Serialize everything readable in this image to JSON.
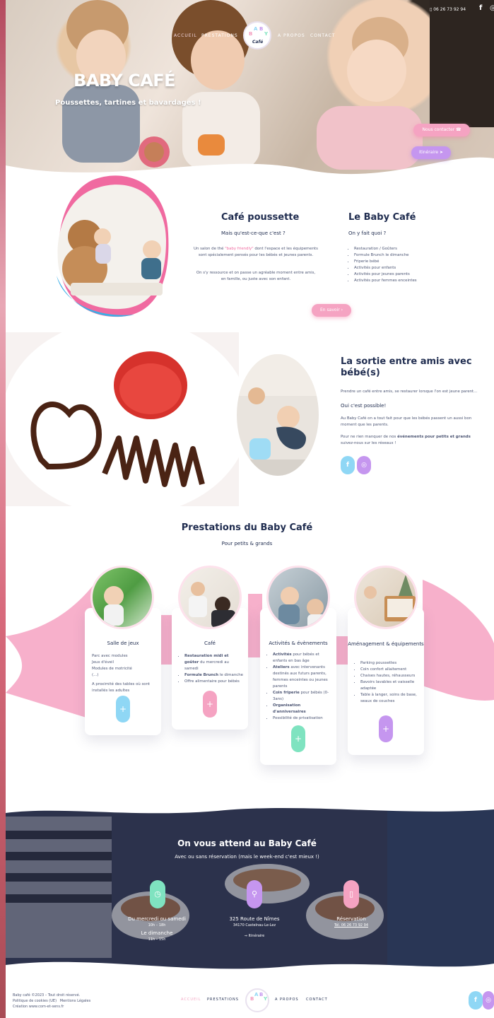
{
  "nav": {
    "items": [
      "Accueil",
      "Prestations",
      "A propos",
      "Contact"
    ],
    "phone": "06 26 73 92 94",
    "facebook": "f",
    "instagram": "◎"
  },
  "hero": {
    "title": "BABY CAFÉ",
    "subtitle": "Poussettes, tartines et bavardages !",
    "contact_button": "Nous contacter ☎",
    "itinerary_button": "Itinéraire ➤"
  },
  "logo": {
    "letters": [
      "B",
      "A",
      "B",
      "Y"
    ],
    "text": "Café"
  },
  "cafe_poussette": {
    "title": "Café poussette",
    "subtitle": "Mais qu'est-ce-que c'est ?",
    "p1_before": "Un salon de thé ",
    "p1_highlight": "\"baby friendly\"",
    "p1_after": " dont l'espace et les équipements sont spécialement pensés pour les bébés et jeunes parents.",
    "p2": "On s'y ressource et on passe un agréable moment entre amis, en famille, ou juste avec son enfant."
  },
  "le_baby_cafe": {
    "title": "Le Baby Café",
    "subtitle": "On y fait quoi ?",
    "items": [
      "Restauration / Goûters",
      "Formule Brunch le dimanche",
      "Friperie bébé",
      "Activités pour enfants",
      "Activités pour jeunes parents",
      "Activités pour femmes enceintes"
    ],
    "button": "En savoir ›"
  },
  "sortie": {
    "title": "La sortie entre amis avec bébé(s)",
    "intro": "Prendre un café entre amis, se restaurer lorsque l'on est jeune parent...",
    "subtitle": "Oui c'est possible!",
    "p1": "Au Baby Café on a tout fait pour que les bébés passent un aussi bon moment que les parents.",
    "p2_before": "Pour ne rien manquer de nos ",
    "p2_bold": "événements pour petits et grands",
    "p2_after": " suivez-nous sur les réseaux !"
  },
  "prestations": {
    "title": "Prestations du Baby Café",
    "subtitle": "Pour petits & grands",
    "cards": [
      {
        "title": "Salle de jeux",
        "lines": [
          "Parc avec modules",
          "Jeux d'éveil",
          "Modules de motricité",
          "(...)",
          "",
          "A proximité des tables où sont installés les adultes"
        ]
      },
      {
        "title": "Café",
        "bullets": [
          {
            "bold": "Restauration midi et goûter",
            "rest": " du mercredi au samedi"
          },
          {
            "bold": "Formule Brunch",
            "rest": " le dimanche"
          },
          {
            "bold": "",
            "rest": "Offre alimentaire pour bébés"
          }
        ]
      },
      {
        "title": "Activités & évènements",
        "bullets": [
          {
            "bold": "Activités",
            "rest": " pour bébés et enfants en bas âge"
          },
          {
            "bold": "Ateliers",
            "rest": " avec intervenants destinés aux futurs parents, femmes enceintes ou jeunes parents"
          },
          {
            "bold": "Coin friperie",
            "rest": " pour bébés (0-3ans)"
          },
          {
            "bold": "Organisation d'anniversaires",
            "rest": ""
          },
          {
            "bold": "",
            "rest": "Possibilité de privatisation"
          }
        ]
      },
      {
        "title": "Aménagement & équipements",
        "items": [
          "Parking poussettes",
          "Coin confort allaitement",
          "Chaises hautes, réhausseurs",
          "Bavoirs lavables et vaisselle adaptée",
          "Table à langer, soins de base, seaux de couches"
        ]
      }
    ],
    "plus": "+"
  },
  "contact": {
    "title": "On vous attend au Baby Café",
    "subtitle": "Avec ou sans réservation (mais le week-end c'est mieux !)",
    "hours_title": "Du mercredi ou samedi",
    "hours_time": "10h – 18h",
    "sunday": "Le dimanche",
    "sunday_time": "11h – 15h",
    "address": "325 Route de Nîmes",
    "city": "34170 Castelnau-Le-Lez",
    "itinerary": "⇒ Itinéraire",
    "reservation": "Réservation",
    "tel": "Tél. 06 26 73 92 94"
  },
  "footer": {
    "copyright": "Baby café ©2023 – Tout droit réservé.",
    "policy": "Politique de cookies (UE)",
    "legal": "Mentions Légales",
    "credit": "Création www.com-et-sens.fr"
  },
  "colors": {
    "pink": "#f5a3c2",
    "purple": "#c596ef",
    "blue": "#8fd7f5",
    "mint": "#7fe3c0",
    "navy": "#1f2c4f"
  }
}
